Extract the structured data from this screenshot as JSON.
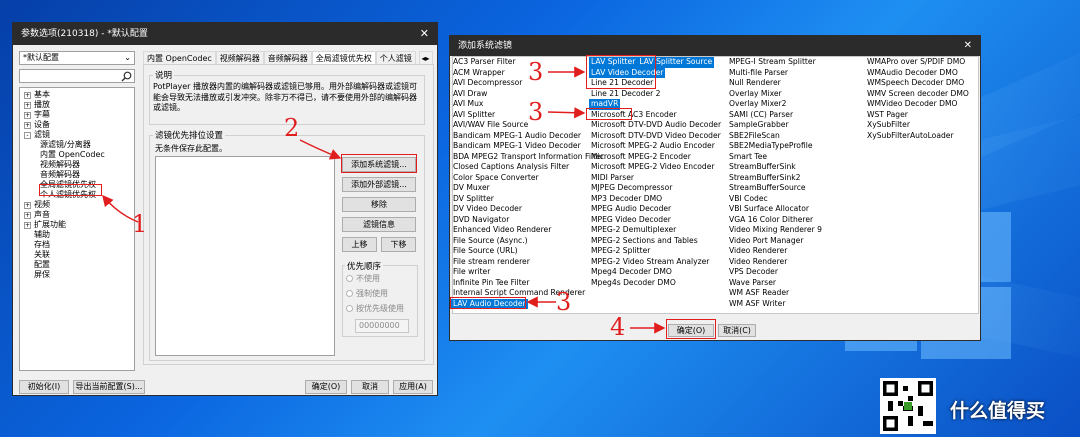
{
  "left_window": {
    "title": "参数选项(210318) - *默认配置",
    "profile": "*默认配置",
    "tree": [
      {
        "label": "基本",
        "expander": "+",
        "depth": 0
      },
      {
        "label": "播放",
        "expander": "+",
        "depth": 0
      },
      {
        "label": "字幕",
        "expander": "+",
        "depth": 0
      },
      {
        "label": "设备",
        "expander": "+",
        "depth": 0
      },
      {
        "label": "滤镜",
        "expander": "-",
        "depth": 0
      },
      {
        "label": "源滤镜/分离器",
        "expander": "",
        "depth": 1
      },
      {
        "label": "内置 OpenCodec",
        "expander": "",
        "depth": 1
      },
      {
        "label": "视频解码器",
        "expander": "",
        "depth": 1
      },
      {
        "label": "音频解码器",
        "expander": "",
        "depth": 1
      },
      {
        "label": "全局滤镜优先权",
        "expander": "",
        "depth": 1
      },
      {
        "label": "个人滤镜优先权",
        "expander": "",
        "depth": 1
      },
      {
        "label": "视频",
        "expander": "+",
        "depth": 0
      },
      {
        "label": "声音",
        "expander": "+",
        "depth": 0
      },
      {
        "label": "扩展功能",
        "expander": "+",
        "depth": 0
      },
      {
        "label": "辅助",
        "expander": "",
        "depth": 0
      },
      {
        "label": "存档",
        "expander": "",
        "depth": 0
      },
      {
        "label": "关联",
        "expander": "",
        "depth": 0
      },
      {
        "label": "配置",
        "expander": "",
        "depth": 0
      },
      {
        "label": "屏保",
        "expander": "",
        "depth": 0
      }
    ],
    "tabs": [
      "内置 OpenCodec",
      "视频解码器",
      "音频解码器",
      "全局滤镜优先权",
      "个人滤镜"
    ],
    "desc_title": "说明",
    "desc_text": "PotPlayer 播放器内置的编解码器或滤镜已够用。用外部编解码器或滤镜可能会导致无法播放或引发冲突。除非万不得已，请不要使用外部的编解码器或滤镜。",
    "priority_title": "滤镜优先排位设置",
    "no_config": "无条件保存此配置。",
    "btn_add_system": "添加系统滤镜...",
    "btn_add_external": "添加外部滤镜...",
    "btn_remove": "移除",
    "btn_info": "滤镜信息",
    "btn_up": "上移",
    "btn_down": "下移",
    "order_title": "优先顺序",
    "radio_1": "不使用",
    "radio_2": "强制使用",
    "radio_3": "按优先级使用",
    "order_value": "00000000",
    "btn_init": "初始化(I)",
    "btn_export": "导出当前配置(S)...",
    "btn_ok": "确定(O)",
    "btn_cancel": "取消",
    "btn_apply": "应用(A)"
  },
  "dialog": {
    "title": "添加系统滤镜",
    "col1": [
      "AC3 Parser Filter",
      "ACM Wrapper",
      "AVI Decompressor",
      "AVI Draw",
      "AVI Mux",
      "AVI Splitter",
      "AVI/WAV File Source",
      "Bandicam MPEG-1 Audio Decoder",
      "Bandicam MPEG-1 Video Decoder",
      "BDA MPEG2 Transport Information Filter",
      "Closed Captions Analysis Filter",
      "Color Space Converter",
      "DV Muxer",
      "DV Splitter",
      "DV Video Decoder",
      "DVD Navigator",
      "Enhanced Video Renderer",
      "File Source (Async.)",
      "File Source (URL)",
      "File stream renderer",
      "File writer",
      "Infinite Pin Tee Filter",
      "Internal Script Command Renderer",
      "LAV Audio Decoder"
    ],
    "col2": [
      "LAV Splitter",
      "LAV Splitter Source",
      "LAV Video Decoder",
      "Line 21 Decoder",
      "Line 21 Decoder 2",
      "madVR",
      "Microsoft AC3 Encoder",
      "Microsoft DTV-DVD Audio Decoder",
      "Microsoft DTV-DVD Video Decoder",
      "Microsoft MPEG-2 Audio Encoder",
      "Microsoft MPEG-2 Encoder",
      "Microsoft MPEG-2 Video Encoder",
      "MIDI Parser",
      "MJPEG Decompressor",
      "MP3 Decoder DMO",
      "MPEG Audio Decoder",
      "MPEG Video Decoder",
      "MPEG-2 Demultiplexer",
      "MPEG-2 Sections and Tables",
      "MPEG-2 Splitter",
      "MPEG-2 Video Stream Analyzer",
      "Mpeg4 Decoder DMO",
      "Mpeg4s Decoder DMO"
    ],
    "col3": [
      "MPEG-I Stream Splitter",
      "Multi-file Parser",
      "Null Renderer",
      "Overlay Mixer",
      "Overlay Mixer2",
      "SAMI (CC) Parser",
      "SampleGrabber",
      "SBE2FileScan",
      "SBE2MediaTypeProfile",
      "Smart Tee",
      "StreamBufferSink",
      "StreamBufferSink2",
      "StreamBufferSource",
      "VBI Codec",
      "VBI Surface Allocator",
      "VGA 16 Color Ditherer",
      "Video Mixing Renderer 9",
      "Video Port Manager",
      "Video Renderer",
      "Video Renderer",
      "VPS Decoder",
      "Wave Parser",
      "WM ASF Reader",
      "WM ASF Writer"
    ],
    "col4": [
      "WMAPro over S/PDIF DMO",
      "WMAudio Decoder DMO",
      "WMSpeech Decoder DMO",
      "WMV Screen decoder DMO",
      "WMVideo Decoder DMO",
      "WST Pager",
      "XySubFilter",
      "XySubFilterAutoLoader"
    ],
    "btn_ok": "确定(O)",
    "btn_cancel": "取消(C)"
  },
  "annotations": [
    "1",
    "2",
    "3",
    "3",
    "3",
    "4"
  ],
  "watermark": "什么值得买"
}
